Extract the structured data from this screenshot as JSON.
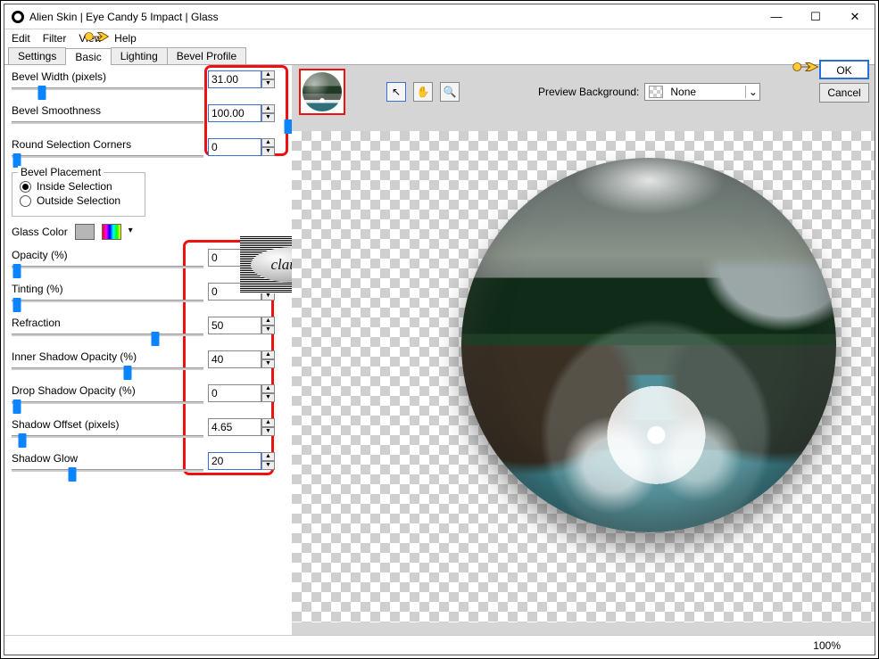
{
  "window": {
    "title": "Alien Skin | Eye Candy 5 Impact | Glass"
  },
  "winbuttons": {
    "min": "—",
    "max": "☐",
    "close": "✕"
  },
  "menu": {
    "edit": "Edit",
    "filter": "Filter",
    "view": "View",
    "help": "Help"
  },
  "tabs": {
    "settings": "Settings",
    "basic": "Basic",
    "lighting": "Lighting",
    "bevel": "Bevel Profile"
  },
  "buttons": {
    "ok": "OK",
    "cancel": "Cancel"
  },
  "preview": {
    "bg_label": "Preview Background:",
    "bg_value": "None"
  },
  "status": {
    "zoom": "100%"
  },
  "params": {
    "bevel_width": {
      "label": "Bevel Width (pixels)",
      "value": "31.00",
      "thumb_pct": 11
    },
    "bevel_smooth": {
      "label": "Bevel Smoothness",
      "value": "100.00",
      "thumb_pct": 100
    },
    "round_corners": {
      "label": "Round Selection Corners",
      "value": "0",
      "thumb_pct": 2
    },
    "opacity": {
      "label": "Opacity (%)",
      "value": "0",
      "thumb_pct": 2
    },
    "tinting": {
      "label": "Tinting (%)",
      "value": "0",
      "thumb_pct": 2
    },
    "refraction": {
      "label": "Refraction",
      "value": "50",
      "thumb_pct": 52
    },
    "inner_shadow": {
      "label": "Inner Shadow Opacity (%)",
      "value": "40",
      "thumb_pct": 42
    },
    "drop_shadow": {
      "label": "Drop Shadow Opacity (%)",
      "value": "0",
      "thumb_pct": 2
    },
    "shadow_offset": {
      "label": "Shadow Offset (pixels)",
      "value": "4.65",
      "thumb_pct": 4
    },
    "shadow_glow": {
      "label": "Shadow Glow",
      "value": "20",
      "thumb_pct": 22
    }
  },
  "placement": {
    "legend": "Bevel Placement",
    "inside": "Inside Selection",
    "outside": "Outside Selection",
    "selected": "inside"
  },
  "glasscolor": {
    "label": "Glass Color"
  },
  "watermark": {
    "text": "claudia"
  },
  "icons": {
    "pointer": "↖",
    "hand": "✋",
    "zoom": "🔍"
  }
}
